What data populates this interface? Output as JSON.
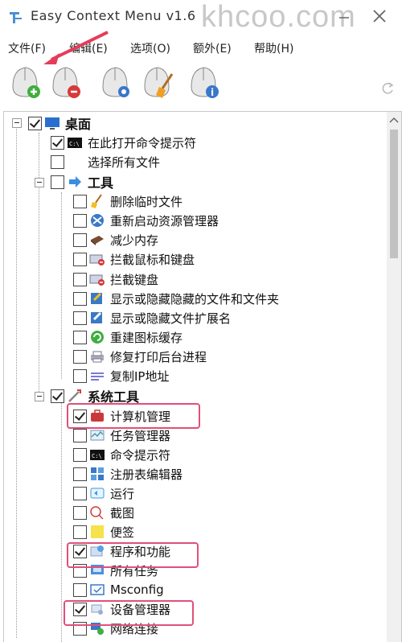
{
  "window": {
    "title": "Easy Context Menu v1.6",
    "watermark": "khcoo.com"
  },
  "menubar": {
    "items": [
      "文件(F)",
      "编辑(E)",
      "选项(O)",
      "额外(E)",
      "帮助(H)"
    ]
  },
  "toolbar": {
    "tools": [
      {
        "name": "add-icon"
      },
      {
        "name": "remove-icon"
      },
      {
        "name": "settings-icon"
      },
      {
        "name": "clean-icon"
      },
      {
        "name": "info-icon"
      }
    ]
  },
  "tree": {
    "desktop": {
      "label": "桌面",
      "checked": true
    },
    "open_cmd": {
      "label": "在此打开命令提示符",
      "checked": true
    },
    "select_all": {
      "label": "选择所有文件",
      "checked": false
    },
    "tools": {
      "label": "工具",
      "checked": false
    },
    "tool_items": [
      {
        "label": "删除临时文件",
        "checked": false
      },
      {
        "label": "重新启动资源管理器",
        "checked": false
      },
      {
        "label": "减少内存",
        "checked": false
      },
      {
        "label": "拦截鼠标和键盘",
        "checked": false
      },
      {
        "label": "拦截键盘",
        "checked": false
      },
      {
        "label": "显示或隐藏隐藏的文件和文件夹",
        "checked": false
      },
      {
        "label": "显示或隐藏文件扩展名",
        "checked": false
      },
      {
        "label": "重建图标缓存",
        "checked": false
      },
      {
        "label": "修复打印后台进程",
        "checked": false
      },
      {
        "label": "复制IP地址",
        "checked": false
      }
    ],
    "system_tools": {
      "label": "系统工具",
      "checked": true
    },
    "system_items": [
      {
        "label": "计算机管理",
        "checked": true
      },
      {
        "label": "任务管理器",
        "checked": false
      },
      {
        "label": "命令提示符",
        "checked": false
      },
      {
        "label": "注册表编辑器",
        "checked": false
      },
      {
        "label": "运行",
        "checked": false
      },
      {
        "label": "截图",
        "checked": false
      },
      {
        "label": "便签",
        "checked": false
      },
      {
        "label": "程序和功能",
        "checked": true
      },
      {
        "label": "所有任务",
        "checked": false
      },
      {
        "label": "Msconfig",
        "checked": false
      },
      {
        "label": "设备管理器",
        "checked": true
      },
      {
        "label": "网络连接",
        "checked": false
      }
    ]
  },
  "colors": {
    "highlight": "#e0507a",
    "arrow": "#e63c5a"
  }
}
